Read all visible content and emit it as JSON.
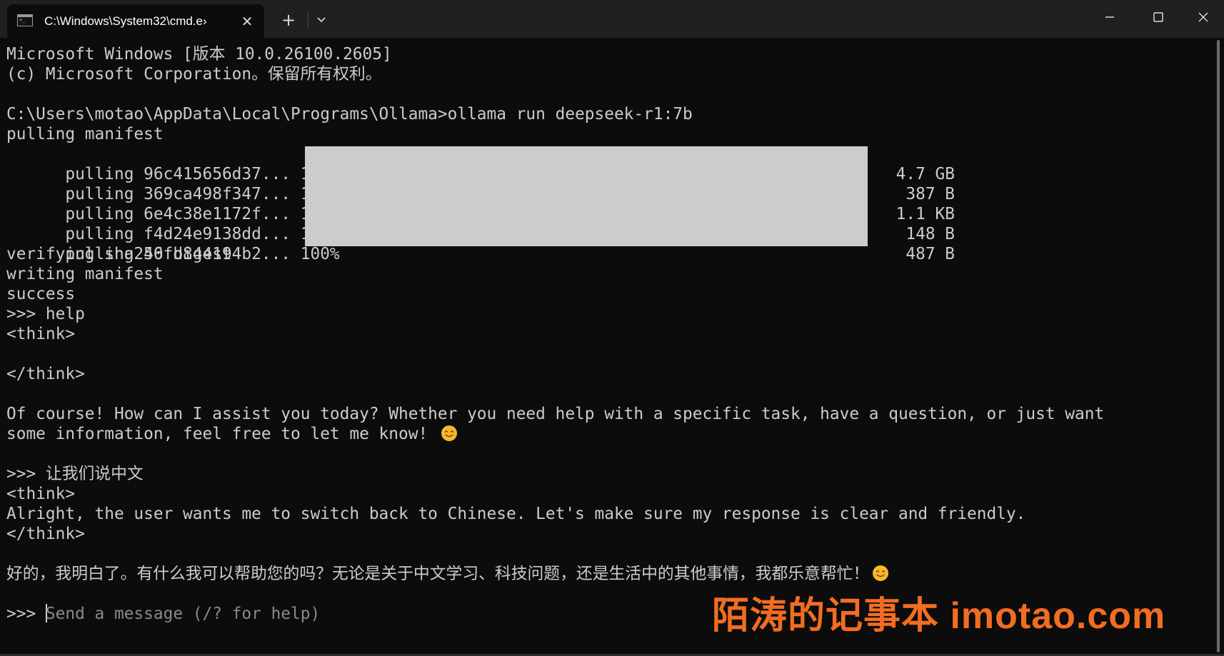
{
  "window": {
    "tab_title": "C:\\Windows\\System32\\cmd.e›",
    "tab_close_glyph": "✕",
    "new_tab_glyph": "+",
    "icons": {
      "tab": "terminal-icon",
      "dropdown": "chevron-down-icon",
      "minimize": "minimize-icon",
      "maximize": "maximize-icon",
      "close": "close-icon"
    }
  },
  "terminal": {
    "header_1": "Microsoft Windows [版本 10.0.26100.2605]",
    "header_2": "(c) Microsoft Corporation。保留所有权利。",
    "command": "C:\\Users\\motao\\AppData\\Local\\Programs\\Ollama>ollama run deepseek-r1:7b",
    "pulling_manifest": "pulling manifest",
    "pulls": [
      {
        "prefix": "pulling 96c415656d37... 100%",
        "size": "4.7 GB"
      },
      {
        "prefix": "pulling 369ca498f347... 100%",
        "size": "387 B"
      },
      {
        "prefix": "pulling 6e4c38e1172f... 100%",
        "size": "1.1 KB"
      },
      {
        "prefix": "pulling f4d24e9138dd... 100%",
        "size": "148 B"
      },
      {
        "prefix": "pulling 40fb844194b2... 100%",
        "size": "487 B"
      }
    ],
    "verifying": "verifying sha256 digest",
    "writing": "writing manifest",
    "success": "success",
    "prompt_help": ">>> help",
    "think_open_1": "<think>",
    "think_close_1": "</think>",
    "answer_1a": "Of course! How can I assist you today? Whether you need help with a specific task, have a question, or just want",
    "answer_1b": "some information, feel free to let me know! ",
    "prompt_chinese": ">>> 让我们说中文",
    "think_open_2": "<think>",
    "think_body_2": "Alright, the user wants me to switch back to Chinese. Let's make sure my response is clear and friendly.",
    "think_close_2": "</think>",
    "answer_2": "好的，我明白了。有什么我可以帮助您的吗？无论是关于中文学习、科技问题，还是生活中的其他事情，我都乐意帮忙！",
    "input_prompt": ">>> ",
    "input_placeholder": "Send a message (/? for help)",
    "emoji_icon": "smiling-face-emoji-icon"
  },
  "watermark": {
    "text": "陌涛的记事本  imotao.com"
  },
  "colors": {
    "background": "#0c0c0c",
    "titlebar": "#202020",
    "text": "#cccccc",
    "placeholder": "#8a8a8a",
    "progress": "#cccccc",
    "watermark": "#f26d21"
  }
}
